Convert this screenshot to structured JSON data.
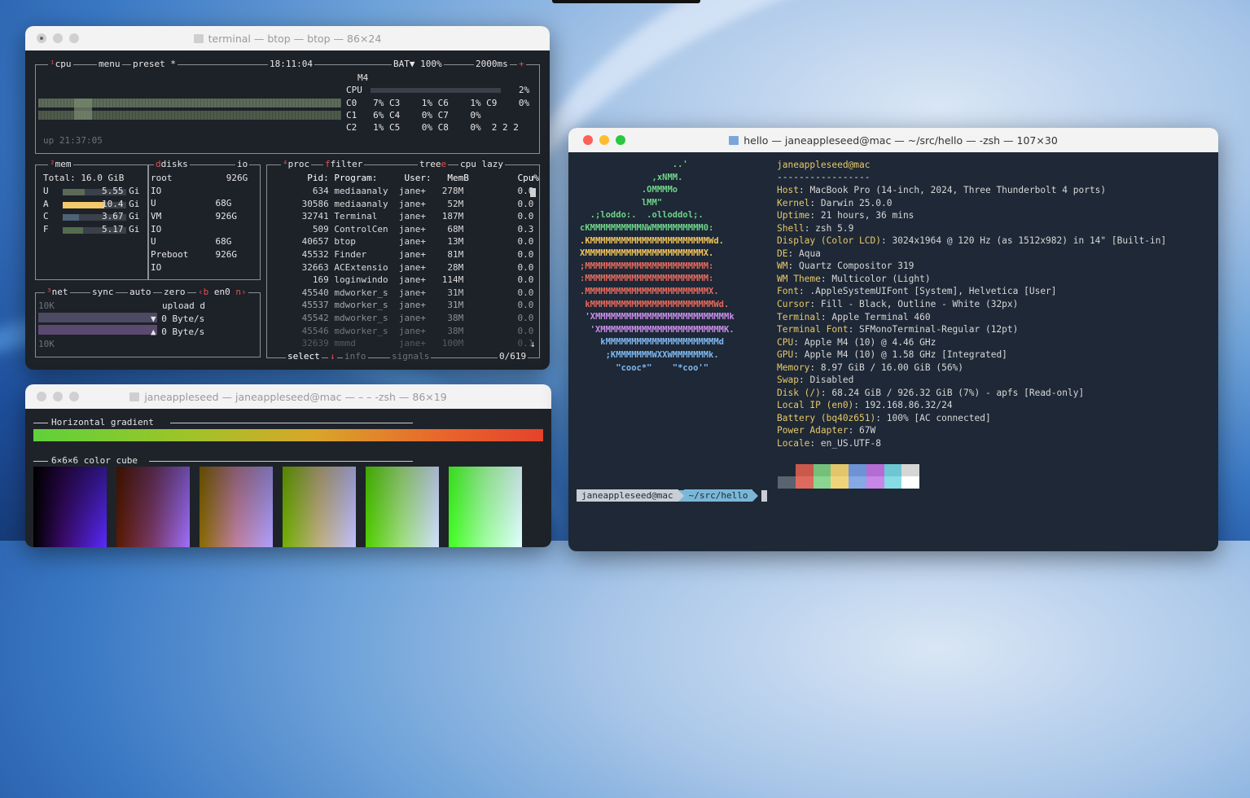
{
  "desktop": {
    "accent": "#3a78c4"
  },
  "btop_window": {
    "title": "terminal — btop — btop — 86×24",
    "cpu_box": {
      "tab_cpu": "cpu",
      "tab_menu": "menu",
      "tab_preset": "preset",
      "preset_mark": "*",
      "clock": "18:11:04",
      "battery": "BAT▼ 100%",
      "refresh": "2000ms",
      "model": "M4",
      "cpu_label": "CPU",
      "cpu_total": "2%",
      "cores": [
        "C0   7% C3    1% C6    1% C9    0%",
        "C1   6% C4    0% C7    0%",
        "C2   1% C5    0% C8    0%  2 2 2"
      ],
      "uptime": "up 21:37:05"
    },
    "mem_box": {
      "title": "mem",
      "total": "Total: 16.0 GiB",
      "rows": [
        {
          "k": "U",
          "v": "5.55 Gi"
        },
        {
          "k": "A",
          "v": "10.4 Gi"
        },
        {
          "k": "C",
          "v": "3.67 Gi"
        },
        {
          "k": "F",
          "v": "5.17 Gi"
        }
      ],
      "fills": [
        0.35,
        0.65,
        0.25,
        0.32
      ]
    },
    "disks_box": {
      "title": "disks",
      "io": "io",
      "rows": [
        "root          926G",
        "IO",
        "U           68G",
        "VM          926G",
        "IO",
        "U           68G",
        "Preboot     926G",
        "IO"
      ]
    },
    "net_box": {
      "title": "net",
      "sync": "sync",
      "auto": "auto",
      "zero": "zero",
      "iface": "en0",
      "scale_top": "10K",
      "scale_bottom": "10K",
      "upload": "upload d",
      "down_rate": "▼ 0 Byte/s",
      "up_rate": "▲ 0 Byte/s"
    },
    "proc_box": {
      "title": "proc",
      "filter": "filter",
      "tree": "tree",
      "cpu_lazy": "cpu lazy",
      "header": "  Pid: Program:     User:   MemB         Cpu%",
      "rows": [
        "   634 mediaanaly  jane+   278M          0.0",
        " 30586 mediaanaly  jane+    52M          0.0",
        " 32741 Terminal    jane+   187M          0.0",
        "   509 ControlCen  jane+    68M          0.3",
        " 40657 btop        jane+    13M          0.0",
        " 45532 Finder      jane+    81M          0.0",
        " 32663 ACExtensio  jane+    28M          0.0",
        "   169 loginwindo  jane+   114M          0.0",
        " 45540 mdworker_s  jane+    31M          0.0",
        " 45537 mdworker_s  jane+    31M          0.0",
        " 45542 mdworker_s  jane+    38M          0.0",
        " 45546 mdworker_s  jane+    38M          0.0",
        " 32639 mmmd        jane+   100M          0.1"
      ],
      "select": "select",
      "info": "info",
      "signals": "signals",
      "count": "0/619"
    }
  },
  "gradient_window": {
    "title": "janeappleseed — janeappleseed@mac — – – -zsh — 86×19",
    "h_gradient": "Horizontal gradient",
    "cube": "6×6×6 color cube"
  },
  "hello_window": {
    "title": "hello — janeappleseed@mac — ~/src/hello — -zsh — 107×30",
    "user_host": "janeappleseed@mac",
    "separator": "-----------------",
    "info": [
      {
        "k": "Host",
        "v": "MacBook Pro (14-inch, 2024, Three Thunderbolt 4 ports)"
      },
      {
        "k": "Kernel",
        "v": "Darwin 25.0.0"
      },
      {
        "k": "Uptime",
        "v": "21 hours, 36 mins"
      },
      {
        "k": "Shell",
        "v": "zsh 5.9"
      },
      {
        "k": "Display (Color LCD)",
        "v": "3024x1964 @ 120 Hz (as 1512x982) in 14\" [Built-in]"
      },
      {
        "k": "DE",
        "v": "Aqua"
      },
      {
        "k": "WM",
        "v": "Quartz Compositor 319"
      },
      {
        "k": "WM Theme",
        "v": "Multicolor (Light)"
      },
      {
        "k": "Font",
        "v": ".AppleSystemUIFont [System], Helvetica [User]"
      },
      {
        "k": "Cursor",
        "v": "Fill - Black, Outline - White (32px)"
      },
      {
        "k": "Terminal",
        "v": "Apple Terminal 460"
      },
      {
        "k": "Terminal Font",
        "v": "SFMonoTerminal-Regular (12pt)"
      },
      {
        "k": "CPU",
        "v": "Apple M4 (10) @ 4.46 GHz"
      },
      {
        "k": "GPU",
        "v": "Apple M4 (10) @ 1.58 GHz [Integrated]"
      },
      {
        "k": "Memory",
        "v": "8.97 GiB / 16.00 GiB (56%)"
      },
      {
        "k": "Swap",
        "v": "Disabled"
      },
      {
        "k": "Disk (/)",
        "v": "68.24 GiB / 926.32 GiB (7%) - apfs [Read-only]"
      },
      {
        "k": "Local IP (en0)",
        "v": "192.168.86.32/24"
      },
      {
        "k": "Battery (bq40z651)",
        "v": "100% [AC connected]"
      },
      {
        "k": "Power Adapter",
        "v": "67W"
      },
      {
        "k": "Locale",
        "v": "en_US.UTF-8"
      }
    ],
    "logo": [
      "                  ..'",
      "              ,xNMM.",
      "            .OMMMMo",
      "            lMM\"",
      "  .;loddo:.  .olloddol;.",
      "cKMMMMMMMMMMNWMMMMMMMMMM0:",
      ".KMMMMMMMMMMMMMMMMMMMMMMMWd.",
      "XMMMMMMMMMMMMMMMMMMMMMMMX.",
      ";MMMMMMMMMMMMMMMMMMMMMMMM:",
      ":MMMMMMMMMMMMMMMMMMMMMMMM:",
      ".MMMMMMMMMMMMMMMMMMMMMMMMX.",
      " kMMMMMMMMMMMMMMMMMMMMMMMMWd.",
      " 'XMMMMMMMMMMMMMMMMMMMMMMMMMMk",
      "  'XMMMMMMMMMMMMMMMMMMMMMMMMK.",
      "    kMMMMMMMMMMMMMMMMMMMMMMd",
      "     ;KMMMMMMMWXXWMMMMMMMk.",
      "       \"cooc*\"    \"*coo'\""
    ],
    "prompt_user": "janeappleseed@mac",
    "prompt_path": "~/src/hello"
  }
}
